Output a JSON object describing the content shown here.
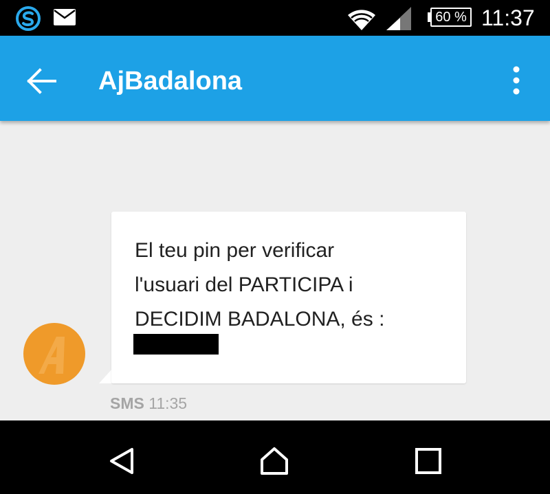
{
  "status_bar": {
    "battery": "60 %",
    "time": "11:37",
    "left_icons": [
      "s-logo-icon",
      "mail-icon"
    ],
    "right_icons": [
      "wifi-icon",
      "signal-icon",
      "battery-icon"
    ]
  },
  "app_bar": {
    "title": "AjBadalona",
    "color": "#1da1e6",
    "icons": [
      "back-arrow-icon",
      "more-vert-icon"
    ]
  },
  "conversation": {
    "messages": [
      {
        "text": "El teu pin per verificar\nl'usuari del PARTICIPA i\nDECIDIM BADALONA, és :",
        "pin_redacted": true,
        "type_label": "SMS",
        "time": "11:35",
        "avatar_color": "#ef9a2a"
      }
    ]
  },
  "nav_bar": {
    "icons": [
      "back-triangle-icon",
      "home-icon",
      "recents-icon"
    ]
  }
}
